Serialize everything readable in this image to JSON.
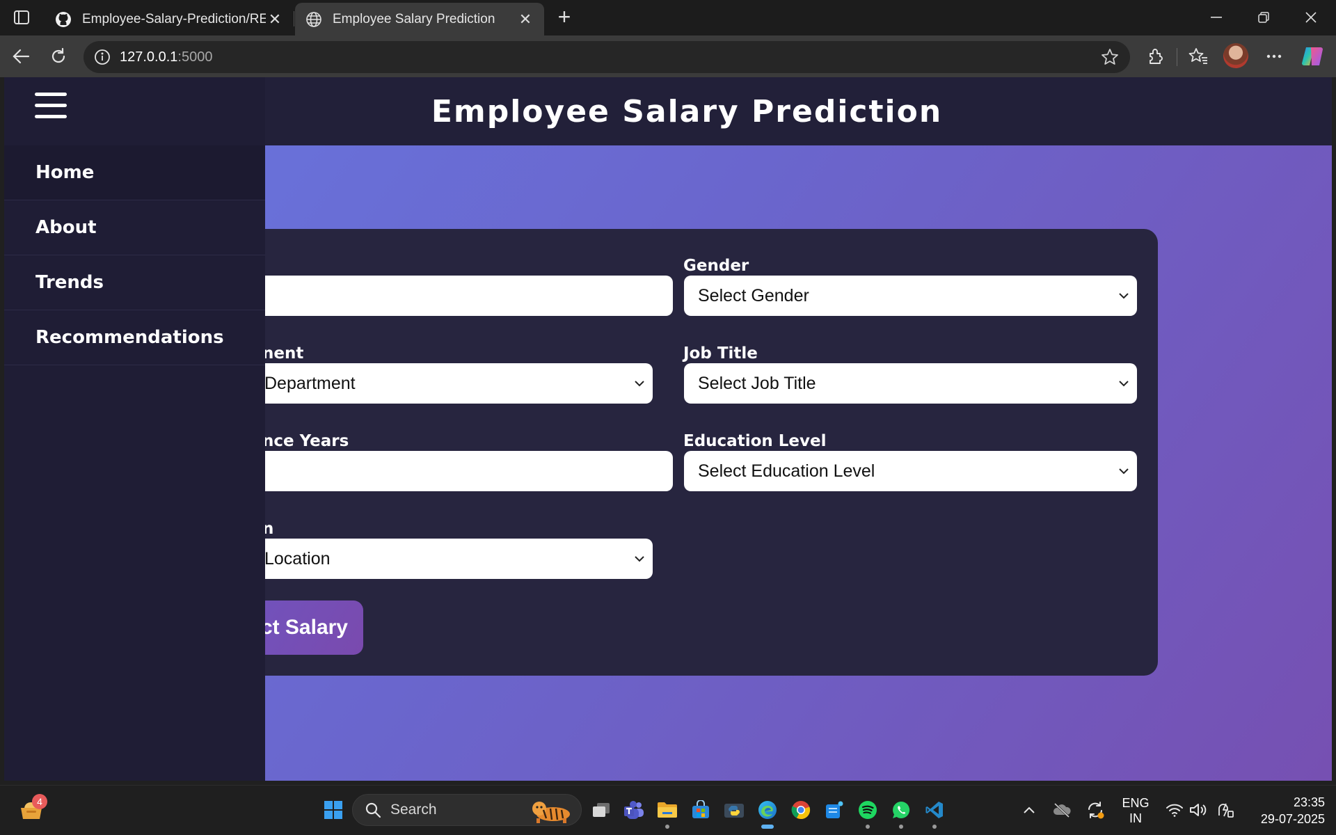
{
  "browser": {
    "tabs": [
      {
        "title": "Employee-Salary-Prediction/READ",
        "icon": "github-icon",
        "active": false
      },
      {
        "title": "Employee Salary Prediction",
        "icon": "globe-icon",
        "active": true
      }
    ],
    "address": {
      "host": "127.0.0.1",
      "port": ":5000"
    }
  },
  "page": {
    "header_title": "Employee Salary Prediction",
    "sidebar": {
      "items": [
        {
          "label": "Home"
        },
        {
          "label": "About"
        },
        {
          "label": "Trends"
        },
        {
          "label": "Recommendations"
        }
      ]
    },
    "form": {
      "age_label": "",
      "gender_label": "Gender",
      "gender_value": "Select Gender",
      "department_label": "nent",
      "department_value": "Department",
      "job_title_label": "Job Title",
      "job_title_value": "Select Job Title",
      "experience_label": "nce Years",
      "education_label": "Education Level",
      "education_value": "Select Education Level",
      "location_label": "n",
      "location_value": "Location",
      "submit_label": "ct Salary"
    }
  },
  "taskbar": {
    "search_label": "Search",
    "widget_badge": "4",
    "language": [
      "ENG",
      "IN"
    ],
    "time": "23:35",
    "date": "29-07-2025"
  },
  "colors": {
    "header_bg": "#222039",
    "card_bg": "#27253f",
    "sidebar_bg": "#1f1d35",
    "gradient_start": "#6877e0",
    "gradient_end": "#7650b2"
  }
}
